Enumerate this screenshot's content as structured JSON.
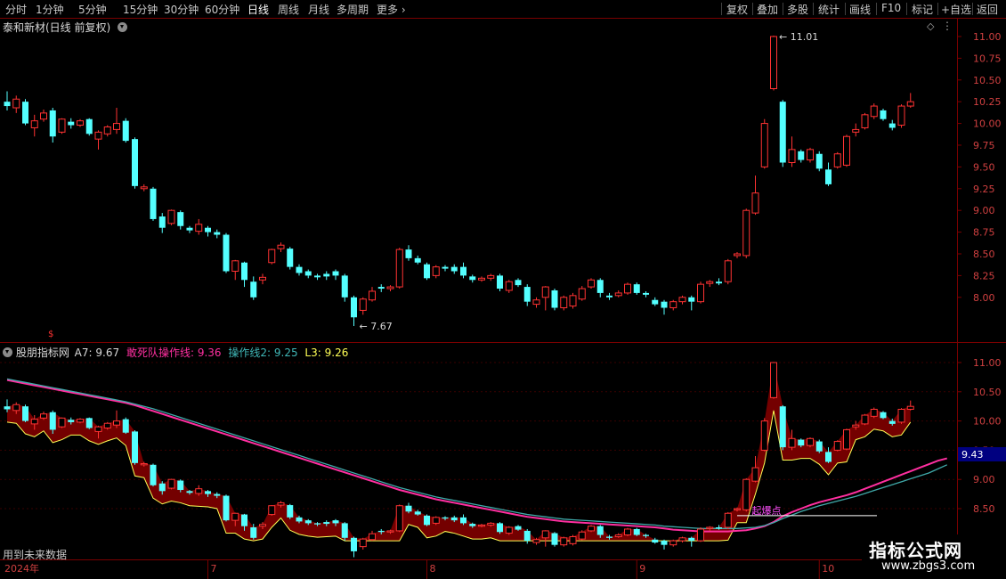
{
  "toolbar": {
    "periods": [
      "分时",
      "1分钟",
      "5分钟",
      "15分钟",
      "30分钟",
      "60分钟",
      "日线",
      "周线",
      "月线",
      "多周期",
      "更多"
    ],
    "active_period": "日线",
    "right_buttons": [
      "复权",
      "叠加",
      "多股",
      "统计",
      "画线",
      "F10",
      "标记",
      "+自选",
      "返回"
    ]
  },
  "main_panel": {
    "title": "泰和新材(日线 前复权)",
    "high_label": "11.01",
    "low_label": "7.67",
    "price_axis": [
      "11.00",
      "10.75",
      "10.50",
      "10.25",
      "10.00",
      "9.75",
      "9.50",
      "9.25",
      "9.00",
      "8.75",
      "8.50",
      "8.25",
      "8.00"
    ]
  },
  "indicator_panel": {
    "name": "股朋指标网",
    "a7_label": "A7:",
    "a7_value": "9.67",
    "line1_label": "敢死队操作线:",
    "line1_value": "9.36",
    "line2_label": "操作线2:",
    "line2_value": "9.25",
    "l3_label": "L3:",
    "l3_value": "9.26",
    "price_axis": [
      "11.00",
      "10.50",
      "10.00",
      "9.50",
      "9.00",
      "8.50"
    ],
    "current_tag": "9.43",
    "annotation": "起爆点",
    "footer_note": "用到未来数据"
  },
  "date_axis": {
    "labels": [
      "2024年",
      "7",
      "8",
      "9",
      "10"
    ]
  },
  "watermark": {
    "title": "指标公式网",
    "url": "www.zbgs3.com"
  },
  "colors": {
    "up": "#ff3232",
    "down": "#54ffff",
    "line1": "#ff2fa0",
    "line2": "#3fa9a9",
    "band_fill": "#7a0000",
    "band_edge": "#ffff55",
    "accent_active": "#ffffff",
    "tag_bg": "#000080"
  },
  "chart_data": {
    "type": "candlestick",
    "title": "泰和新材(日线 前复权)",
    "x_labels": [
      "2024年",
      "7",
      "8",
      "9",
      "10"
    ],
    "ylim_main": [
      7.6,
      11.1
    ],
    "ylim_indicator": [
      7.8,
      11.2
    ],
    "candles": [
      {
        "o": 10.25,
        "c": 10.2,
        "h": 10.37,
        "l": 10.15
      },
      {
        "o": 10.18,
        "c": 10.28,
        "h": 10.32,
        "l": 10.12
      },
      {
        "o": 10.25,
        "c": 10.0,
        "h": 10.28,
        "l": 9.98
      },
      {
        "o": 9.95,
        "c": 10.03,
        "h": 10.1,
        "l": 9.85
      },
      {
        "o": 10.05,
        "c": 10.12,
        "h": 10.16,
        "l": 10.02
      },
      {
        "o": 10.15,
        "c": 9.85,
        "h": 10.18,
        "l": 9.78
      },
      {
        "o": 9.9,
        "c": 10.05,
        "h": 10.06,
        "l": 9.88
      },
      {
        "o": 10.02,
        "c": 9.98,
        "h": 10.06,
        "l": 9.94
      },
      {
        "o": 9.98,
        "c": 10.03,
        "h": 10.05,
        "l": 9.96
      },
      {
        "o": 10.05,
        "c": 9.88,
        "h": 10.06,
        "l": 9.86
      },
      {
        "o": 9.82,
        "c": 9.9,
        "h": 9.92,
        "l": 9.7
      },
      {
        "o": 9.88,
        "c": 9.96,
        "h": 9.98,
        "l": 9.85
      },
      {
        "o": 9.93,
        "c": 10.0,
        "h": 10.18,
        "l": 9.88
      },
      {
        "o": 10.03,
        "c": 9.8,
        "h": 10.06,
        "l": 9.78
      },
      {
        "o": 9.82,
        "c": 9.28,
        "h": 9.84,
        "l": 9.25
      },
      {
        "o": 9.25,
        "c": 9.27,
        "h": 9.3,
        "l": 9.22
      },
      {
        "o": 9.25,
        "c": 8.9,
        "h": 9.27,
        "l": 8.88
      },
      {
        "o": 8.93,
        "c": 8.8,
        "h": 8.97,
        "l": 8.74
      },
      {
        "o": 8.85,
        "c": 9.0,
        "h": 9.01,
        "l": 8.83
      },
      {
        "o": 8.98,
        "c": 8.82,
        "h": 9.0,
        "l": 8.78
      },
      {
        "o": 8.8,
        "c": 8.77,
        "h": 8.82,
        "l": 8.74
      },
      {
        "o": 8.76,
        "c": 8.84,
        "h": 8.9,
        "l": 8.72
      },
      {
        "o": 8.8,
        "c": 8.75,
        "h": 8.82,
        "l": 8.7
      },
      {
        "o": 8.75,
        "c": 8.72,
        "h": 8.78,
        "l": 8.68
      },
      {
        "o": 8.72,
        "c": 8.3,
        "h": 8.74,
        "l": 8.28
      },
      {
        "o": 8.3,
        "c": 8.42,
        "h": 8.43,
        "l": 8.2
      },
      {
        "o": 8.4,
        "c": 8.2,
        "h": 8.41,
        "l": 8.12
      },
      {
        "o": 8.18,
        "c": 8.0,
        "h": 8.24,
        "l": 7.97
      },
      {
        "o": 8.2,
        "c": 8.23,
        "h": 8.27,
        "l": 8.15
      },
      {
        "o": 8.4,
        "c": 8.55,
        "h": 8.56,
        "l": 8.38
      },
      {
        "o": 8.56,
        "c": 8.6,
        "h": 8.63,
        "l": 8.52
      },
      {
        "o": 8.56,
        "c": 8.35,
        "h": 8.58,
        "l": 8.32
      },
      {
        "o": 8.35,
        "c": 8.28,
        "h": 8.38,
        "l": 8.25
      },
      {
        "o": 8.3,
        "c": 8.25,
        "h": 8.32,
        "l": 8.22
      },
      {
        "o": 8.25,
        "c": 8.23,
        "h": 8.27,
        "l": 8.2
      },
      {
        "o": 8.27,
        "c": 8.24,
        "h": 8.3,
        "l": 8.2
      },
      {
        "o": 8.3,
        "c": 8.25,
        "h": 8.32,
        "l": 8.2
      },
      {
        "o": 8.25,
        "c": 8.0,
        "h": 8.27,
        "l": 7.95
      },
      {
        "o": 8.0,
        "c": 7.77,
        "h": 8.02,
        "l": 7.67
      },
      {
        "o": 7.85,
        "c": 7.98,
        "h": 8.0,
        "l": 7.8
      },
      {
        "o": 7.97,
        "c": 8.07,
        "h": 8.12,
        "l": 7.95
      },
      {
        "o": 8.12,
        "c": 8.1,
        "h": 8.15,
        "l": 8.06
      },
      {
        "o": 8.1,
        "c": 8.12,
        "h": 8.14,
        "l": 8.07
      },
      {
        "o": 8.12,
        "c": 8.55,
        "h": 8.57,
        "l": 8.1
      },
      {
        "o": 8.55,
        "c": 8.45,
        "h": 8.6,
        "l": 8.42
      },
      {
        "o": 8.45,
        "c": 8.4,
        "h": 8.48,
        "l": 8.38
      },
      {
        "o": 8.38,
        "c": 8.22,
        "h": 8.4,
        "l": 8.2
      },
      {
        "o": 8.25,
        "c": 8.35,
        "h": 8.37,
        "l": 8.22
      },
      {
        "o": 8.35,
        "c": 8.33,
        "h": 8.37,
        "l": 8.3
      },
      {
        "o": 8.35,
        "c": 8.3,
        "h": 8.38,
        "l": 8.27
      },
      {
        "o": 8.35,
        "c": 8.25,
        "h": 8.4,
        "l": 8.22
      },
      {
        "o": 8.24,
        "c": 8.2,
        "h": 8.26,
        "l": 8.17
      },
      {
        "o": 8.2,
        "c": 8.22,
        "h": 8.24,
        "l": 8.18
      },
      {
        "o": 8.22,
        "c": 8.25,
        "h": 8.27,
        "l": 8.19
      },
      {
        "o": 8.25,
        "c": 8.1,
        "h": 8.27,
        "l": 8.07
      },
      {
        "o": 8.08,
        "c": 8.18,
        "h": 8.2,
        "l": 8.05
      },
      {
        "o": 8.2,
        "c": 8.14,
        "h": 8.22,
        "l": 8.12
      },
      {
        "o": 8.12,
        "c": 7.95,
        "h": 8.15,
        "l": 7.9
      },
      {
        "o": 7.92,
        "c": 7.97,
        "h": 8.0,
        "l": 7.88
      },
      {
        "o": 8.0,
        "c": 8.12,
        "h": 8.13,
        "l": 7.85
      },
      {
        "o": 8.08,
        "c": 7.88,
        "h": 8.1,
        "l": 7.85
      },
      {
        "o": 7.88,
        "c": 8.0,
        "h": 8.02,
        "l": 7.85
      },
      {
        "o": 7.9,
        "c": 8.02,
        "h": 8.05,
        "l": 7.87
      },
      {
        "o": 7.98,
        "c": 8.1,
        "h": 8.13,
        "l": 7.96
      },
      {
        "o": 8.12,
        "c": 8.2,
        "h": 8.22,
        "l": 8.1
      },
      {
        "o": 8.2,
        "c": 8.05,
        "h": 8.22,
        "l": 8.0
      },
      {
        "o": 8.02,
        "c": 8.0,
        "h": 8.05,
        "l": 7.97
      },
      {
        "o": 8.02,
        "c": 8.05,
        "h": 8.08,
        "l": 8.0
      },
      {
        "o": 8.05,
        "c": 8.15,
        "h": 8.17,
        "l": 8.03
      },
      {
        "o": 8.15,
        "c": 8.05,
        "h": 8.17,
        "l": 8.03
      },
      {
        "o": 8.05,
        "c": 8.03,
        "h": 8.07,
        "l": 8.0
      },
      {
        "o": 7.97,
        "c": 7.92,
        "h": 8.0,
        "l": 7.9
      },
      {
        "o": 7.95,
        "c": 7.88,
        "h": 7.97,
        "l": 7.8
      },
      {
        "o": 7.88,
        "c": 7.95,
        "h": 7.97,
        "l": 7.85
      },
      {
        "o": 7.95,
        "c": 8.0,
        "h": 8.02,
        "l": 7.92
      },
      {
        "o": 8.0,
        "c": 7.95,
        "h": 8.02,
        "l": 7.85
      },
      {
        "o": 7.95,
        "c": 8.15,
        "h": 8.18,
        "l": 7.93
      },
      {
        "o": 8.16,
        "c": 8.18,
        "h": 8.2,
        "l": 8.12
      },
      {
        "o": 8.18,
        "c": 8.16,
        "h": 8.22,
        "l": 8.14
      },
      {
        "o": 8.18,
        "c": 8.42,
        "h": 8.44,
        "l": 8.15
      },
      {
        "o": 8.48,
        "c": 8.5,
        "h": 8.52,
        "l": 8.45
      },
      {
        "o": 8.48,
        "c": 9.0,
        "h": 9.02,
        "l": 8.45
      },
      {
        "o": 8.97,
        "c": 9.2,
        "h": 9.4,
        "l": 8.95
      },
      {
        "o": 9.5,
        "c": 10.0,
        "h": 10.05,
        "l": 9.48
      },
      {
        "o": 10.4,
        "c": 11.0,
        "h": 11.01,
        "l": 10.38
      },
      {
        "o": 10.25,
        "c": 9.55,
        "h": 10.27,
        "l": 9.5
      },
      {
        "o": 9.55,
        "c": 9.7,
        "h": 9.85,
        "l": 9.5
      },
      {
        "o": 9.68,
        "c": 9.58,
        "h": 9.7,
        "l": 9.55
      },
      {
        "o": 9.58,
        "c": 9.7,
        "h": 9.72,
        "l": 9.55
      },
      {
        "o": 9.65,
        "c": 9.48,
        "h": 9.68,
        "l": 9.45
      },
      {
        "o": 9.47,
        "c": 9.3,
        "h": 9.55,
        "l": 9.28
      },
      {
        "o": 9.5,
        "c": 9.65,
        "h": 9.67,
        "l": 9.48
      },
      {
        "o": 9.52,
        "c": 9.85,
        "h": 9.87,
        "l": 9.5
      },
      {
        "o": 9.9,
        "c": 9.93,
        "h": 10.0,
        "l": 9.85
      },
      {
        "o": 9.95,
        "c": 10.1,
        "h": 10.12,
        "l": 9.93
      },
      {
        "o": 10.08,
        "c": 10.2,
        "h": 10.23,
        "l": 10.05
      },
      {
        "o": 10.15,
        "c": 10.05,
        "h": 10.17,
        "l": 10.03
      },
      {
        "o": 10.0,
        "c": 9.95,
        "h": 10.04,
        "l": 9.92
      },
      {
        "o": 9.98,
        "c": 10.2,
        "h": 10.22,
        "l": 9.95
      },
      {
        "o": 10.2,
        "c": 10.25,
        "h": 10.35,
        "l": 10.18
      }
    ],
    "series": [
      {
        "name": "敢死队操作线",
        "values": [
          10.7,
          10.67,
          10.64,
          10.61,
          10.58,
          10.55,
          10.52,
          10.49,
          10.46,
          10.43,
          10.4,
          10.37,
          10.34,
          10.31,
          10.27,
          10.22,
          10.17,
          10.12,
          10.07,
          10.02,
          9.97,
          9.92,
          9.87,
          9.82,
          9.77,
          9.72,
          9.67,
          9.62,
          9.57,
          9.52,
          9.47,
          9.42,
          9.37,
          9.32,
          9.27,
          9.22,
          9.17,
          9.12,
          9.07,
          9.02,
          8.97,
          8.92,
          8.87,
          8.82,
          8.78,
          8.74,
          8.7,
          8.66,
          8.63,
          8.6,
          8.57,
          8.54,
          8.51,
          8.48,
          8.45,
          8.42,
          8.39,
          8.36,
          8.34,
          8.32,
          8.3,
          8.28,
          8.27,
          8.26,
          8.25,
          8.24,
          8.23,
          8.22,
          8.21,
          8.2,
          8.19,
          8.18,
          8.16,
          8.14,
          8.13,
          8.12,
          8.11,
          8.11,
          8.11,
          8.11,
          8.12,
          8.13,
          8.16,
          8.2,
          8.27,
          8.37,
          8.44,
          8.5,
          8.56,
          8.61,
          8.65,
          8.69,
          8.73,
          8.78,
          8.84,
          8.9,
          8.96,
          9.02,
          9.08,
          9.14,
          9.2,
          9.26,
          9.32,
          9.36
        ]
      },
      {
        "name": "操作线2",
        "values": [
          10.72,
          10.69,
          10.66,
          10.63,
          10.6,
          10.57,
          10.54,
          10.51,
          10.48,
          10.45,
          10.42,
          10.39,
          10.36,
          10.33,
          10.29,
          10.25,
          10.21,
          10.16,
          10.11,
          10.06,
          10.01,
          9.96,
          9.91,
          9.86,
          9.81,
          9.76,
          9.71,
          9.66,
          9.61,
          9.56,
          9.51,
          9.46,
          9.41,
          9.36,
          9.31,
          9.26,
          9.21,
          9.16,
          9.11,
          9.06,
          9.01,
          8.96,
          8.91,
          8.86,
          8.82,
          8.78,
          8.74,
          8.7,
          8.67,
          8.64,
          8.61,
          8.58,
          8.55,
          8.52,
          8.49,
          8.46,
          8.43,
          8.4,
          8.38,
          8.36,
          8.34,
          8.32,
          8.31,
          8.3,
          8.29,
          8.28,
          8.27,
          8.26,
          8.25,
          8.24,
          8.23,
          8.22,
          8.2,
          8.19,
          8.18,
          8.17,
          8.16,
          8.16,
          8.16,
          8.16,
          8.16,
          8.17,
          8.18,
          8.21,
          8.26,
          8.33,
          8.39,
          8.45,
          8.5,
          8.55,
          8.59,
          8.63,
          8.67,
          8.71,
          8.76,
          8.81,
          8.86,
          8.91,
          8.96,
          9.01,
          9.06,
          9.11,
          9.18,
          9.25
        ]
      }
    ],
    "legend": "top-left"
  }
}
